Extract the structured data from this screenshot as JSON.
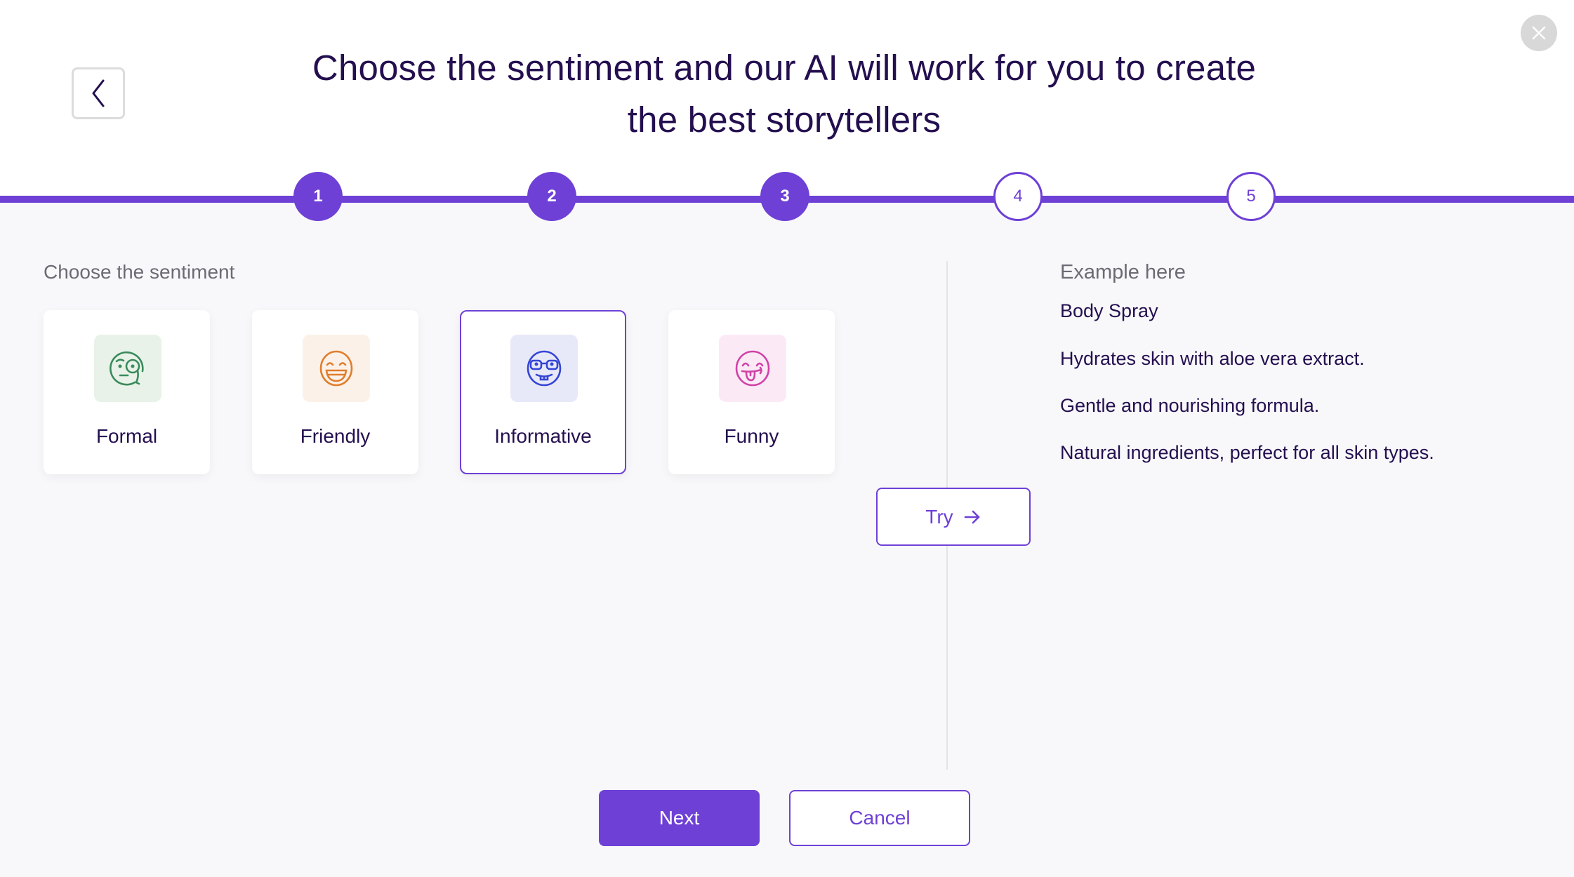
{
  "header": {
    "title_line1": "Choose the sentiment and our AI will work for you to create",
    "title_line2": "the best storytellers",
    "back_icon": "chevron-left-icon",
    "close_icon": "close-icon"
  },
  "stepper": {
    "current_step": 3,
    "total_steps": 5,
    "steps": [
      {
        "label": "1",
        "state": "done"
      },
      {
        "label": "2",
        "state": "done"
      },
      {
        "label": "3",
        "state": "done"
      },
      {
        "label": "4",
        "state": "todo"
      },
      {
        "label": "5",
        "state": "todo"
      }
    ]
  },
  "sentiment": {
    "label": "Choose the sentiment",
    "selected": "Informative",
    "options": [
      {
        "label": "Formal",
        "icon": "monocle-face-icon",
        "color": "#3a8a5c",
        "tile": "#e9f2e9"
      },
      {
        "label": "Friendly",
        "icon": "grinning-face-icon",
        "color": "#e07d2c",
        "tile": "#fcf1e8"
      },
      {
        "label": "Informative",
        "icon": "nerd-face-icon",
        "color": "#3545d6",
        "tile": "#e8e9f8"
      },
      {
        "label": "Funny",
        "icon": "tongue-face-icon",
        "color": "#d042a8",
        "tile": "#fbeaf5"
      }
    ]
  },
  "try_button": {
    "label": "Try",
    "icon": "arrow-right-icon"
  },
  "example": {
    "label": "Example here",
    "lines": [
      "Body Spray",
      "Hydrates skin with aloe vera extract.",
      "Gentle and nourishing formula.",
      "Natural ingredients, perfect for all skin types."
    ]
  },
  "footer": {
    "next_label": "Next",
    "cancel_label": "Cancel"
  },
  "colors": {
    "accent": "#6e40d6",
    "text_dark": "#240f4f",
    "text_muted": "#6b6b75",
    "background": "#f8f8fa"
  }
}
